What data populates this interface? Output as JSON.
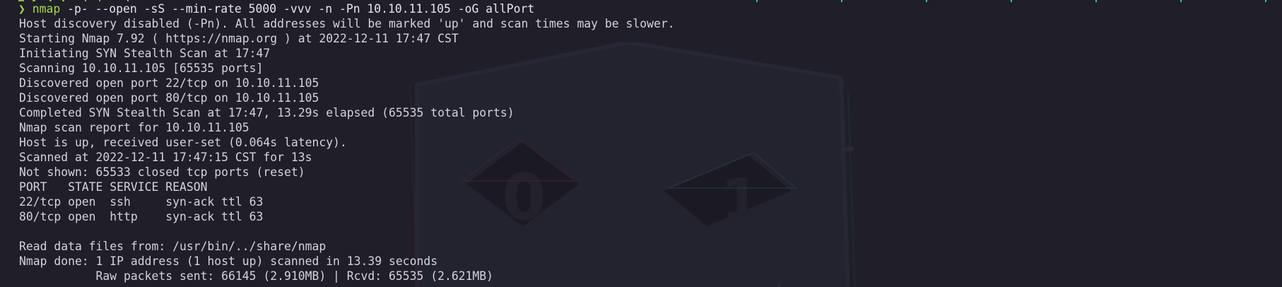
{
  "prompt": {
    "arrow": "❯",
    "command": "nmap",
    "args": " -p- --open -sS --min-rate 5000 -vvv -n -Pn 10.10.11.105 -oG allPort"
  },
  "output": [
    "Host discovery disabled (-Pn). All addresses will be marked 'up' and scan times may be slower.",
    "Starting Nmap 7.92 ( https://nmap.org ) at 2022-12-11 17:47 CST",
    "Initiating SYN Stealth Scan at 17:47",
    "Scanning 10.10.11.105 [65535 ports]",
    "Discovered open port 22/tcp on 10.10.11.105",
    "Discovered open port 80/tcp on 10.10.11.105",
    "Completed SYN Stealth Scan at 17:47, 13.29s elapsed (65535 total ports)",
    "Nmap scan report for 10.10.11.105",
    "Host is up, received user-set (0.064s latency).",
    "Scanned at 2022-12-11 17:47:15 CST for 13s",
    "Not shown: 65533 closed tcp ports (reset)",
    "PORT   STATE SERVICE REASON",
    "22/tcp open  ssh     syn-ack ttl 63",
    "80/tcp open  http    syn-ack ttl 63",
    "",
    "Read data files from: /usr/bin/../share/nmap",
    "Nmap done: 1 IP address (1 host up) scanned in 13.39 seconds",
    "           Raw packets sent: 66145 (2.910MB) | Rcvd: 65535 (2.621MB)"
  ],
  "colors": {
    "background": "#1f1e29",
    "text": "#d4d4dc",
    "prompt_accent": "#a6d94a"
  }
}
